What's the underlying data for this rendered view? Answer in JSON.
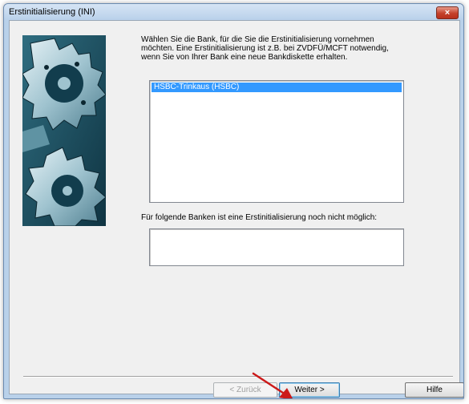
{
  "window": {
    "title": "Erstinitialisierung (INI)",
    "close_label": "×"
  },
  "content": {
    "description_lines": [
      "Wählen Sie die Bank, für die Sie die Erstinitialisierung vornehmen",
      "möchten. Eine Erstinitialisierung ist z.B. bei ZVDFÜ/MCFT notwendig,",
      "wenn Sie von Ihrer Bank eine neue Bankdiskette erhalten."
    ],
    "banks": [
      {
        "label": "HSBC-Trinkaus (HSBC)",
        "selected": true
      }
    ],
    "unavailable_label": "Für folgende Banken ist eine Erstinitialisierung noch nicht möglich:",
    "unavailable_banks": []
  },
  "buttons": {
    "back_label": "< Zurück",
    "next_label": "Weiter >",
    "help_label": "Hilfe"
  },
  "colors": {
    "selection": "#3399ff",
    "annotation_arrow": "#cc1a1a",
    "close_button": "#c4402a"
  },
  "icons": {
    "side_image": "gears-illustration",
    "annotation": "red-arrow-pointer"
  }
}
